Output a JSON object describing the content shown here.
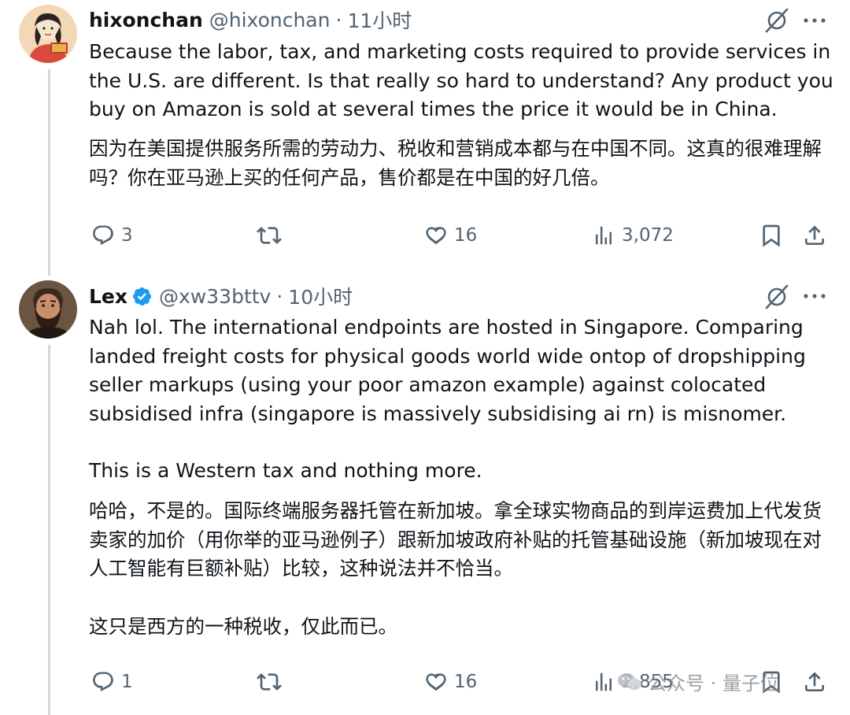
{
  "tweets": [
    {
      "name": "hixonchan",
      "handle": "@hixonchan",
      "separator": "·",
      "time": "11小时",
      "text": "Because the labor, tax, and marketing costs required to provide services in the U.S. are different. Is that really so hard to understand? Any product you buy on Amazon is sold at several times the price it would be in China.",
      "translation": "因为在美国提供服务所需的劳动力、税收和营销成本都与在中国不同。这真的很难理解吗？你在亚马逊上买的任何产品，售价都是在中国的好几倍。",
      "replies": "3",
      "retweets": "",
      "likes": "16",
      "views": "3,072"
    },
    {
      "name": "Lex",
      "handle": "@xw33bttv",
      "separator": "·",
      "time": "10小时",
      "verified": true,
      "text_p1": "Nah lol. The international endpoints are hosted in Singapore. Comparing landed freight costs for physical goods world wide ontop of dropshipping seller markups (using your poor amazon example) against colocated subsidised infra (singapore is massively subsidising ai rn) is misnomer.",
      "text_p2": "This is a Western tax and nothing more.",
      "translation_p1": "哈哈，不是的。国际终端服务器托管在新加坡。拿全球实物商品的到岸运费加上代发货卖家的加价（用你举的亚马逊例子）跟新加坡政府补贴的托管基础设施（新加坡现在对人工智能有巨额补贴）比较，这种说法并不恰当。",
      "translation_p2": "这只是西方的一种税收，仅此而已。",
      "replies": "1",
      "retweets": "",
      "likes": "16",
      "views": "2,855"
    }
  ],
  "watermark": {
    "text": "公众号 · 量子位"
  },
  "colors": {
    "text": "#0f1419",
    "secondary": "#536471",
    "thread_line": "#cfd9de",
    "verified": "#1d9bf0"
  }
}
